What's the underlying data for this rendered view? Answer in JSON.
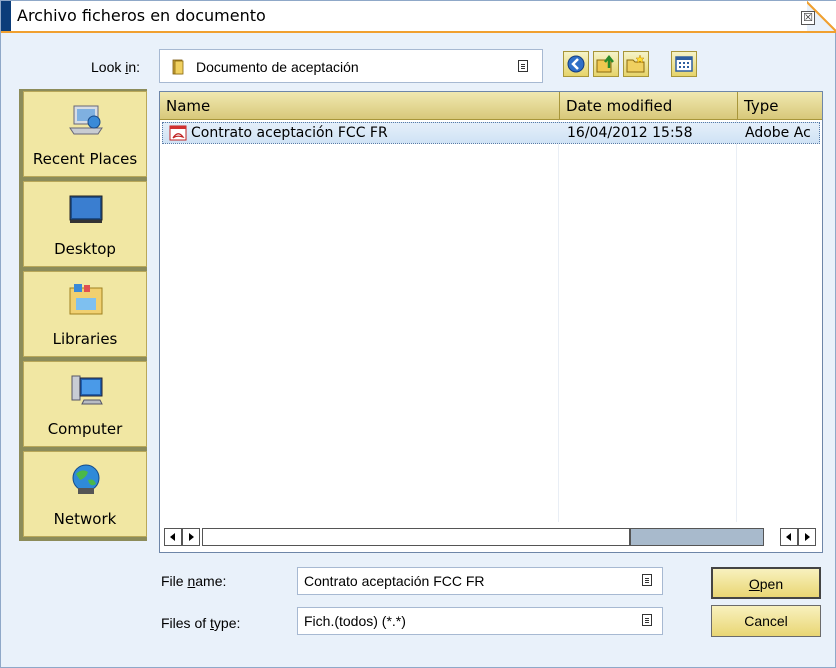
{
  "window": {
    "title": "Archivo ficheros en documento",
    "close_glyph": "☒"
  },
  "lookin": {
    "label_prefix": "Look ",
    "label_underlined": "i",
    "label_suffix": "n:",
    "value": "Documento de aceptación"
  },
  "toolbar": {
    "icons": [
      "back-icon",
      "up-folder-icon",
      "new-folder-icon",
      "view-menu-icon"
    ]
  },
  "places": [
    {
      "label": "Recent Places",
      "icon": "recent-places-icon"
    },
    {
      "label": "Desktop",
      "icon": "desktop-icon"
    },
    {
      "label": "Libraries",
      "icon": "libraries-icon"
    },
    {
      "label": "Computer",
      "icon": "computer-icon"
    },
    {
      "label": "Network",
      "icon": "network-icon"
    }
  ],
  "filelist": {
    "columns": [
      "Name",
      "Date modified",
      "Type"
    ],
    "rows": [
      {
        "name": "Contrato aceptación FCC FR",
        "date": "16/04/2012 15:58",
        "type": "Adobe Ac",
        "icon": "pdf-icon"
      }
    ]
  },
  "bottom": {
    "filename_label_prefix": "File ",
    "filename_label_underlined": "n",
    "filename_label_suffix": "ame:",
    "filename_value": "Contrato aceptación FCC FR",
    "filetype_label_prefix": "Files of ",
    "filetype_label_underlined": "t",
    "filetype_label_suffix": "ype:",
    "filetype_value": "Fich.(todos) (*.*)",
    "open_underlined": "O",
    "open_rest": "pen",
    "cancel_label": "Cancel"
  },
  "colors": {
    "title_accent": "#0b3d7a",
    "orange_line": "#f0a030",
    "places_bg": "#f1e7a3",
    "selection": "#cfe2f5"
  }
}
